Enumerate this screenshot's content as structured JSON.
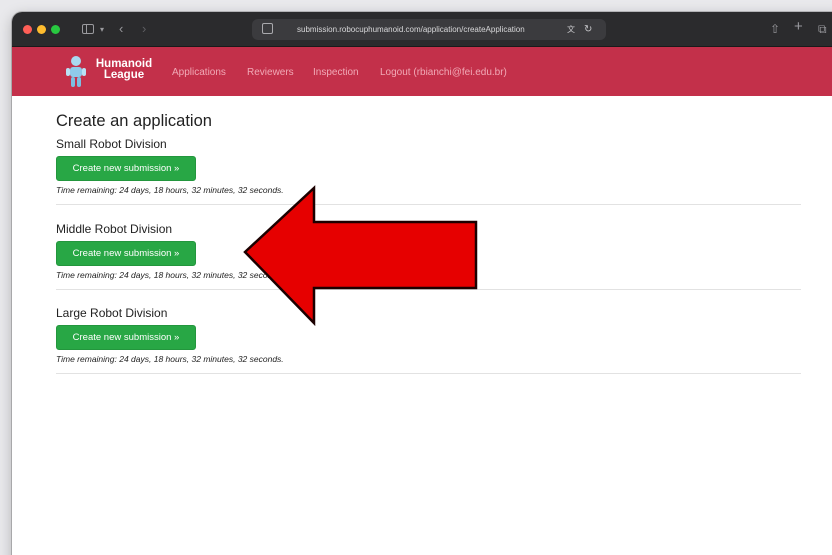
{
  "browser": {
    "url": "submission.robocuphumanoid.com/application/createApplication"
  },
  "navbar": {
    "logo_line1": "Humanoid",
    "logo_line2": "League",
    "links": [
      "Applications",
      "Reviewers",
      "Inspection",
      "Logout (rbianchi@fei.edu.br)"
    ]
  },
  "page": {
    "title": "Create an application",
    "divisions": [
      {
        "name": "Small Robot Division",
        "button_label": "Create new submission »",
        "remaining": "Time remaining: 24 days, 18 hours, 32 minutes, 32 seconds."
      },
      {
        "name": "Middle Robot Division",
        "button_label": "Create new submission »",
        "remaining": "Time remaining: 24 days, 18 hours, 32 minutes, 32 seconds."
      },
      {
        "name": "Large Robot Division",
        "button_label": "Create new submission »",
        "remaining": "Time remaining: 24 days, 18 hours, 32 minutes, 32 seconds."
      }
    ]
  },
  "colors": {
    "navbar": "#c3304a",
    "button": "#28a745",
    "arrow": "#e60000"
  },
  "icons": [
    "sidebar-icon",
    "back-icon",
    "forward-icon",
    "share-icon",
    "new-tab-icon",
    "tabs-overview-icon",
    "reload-icon",
    "translate-icon",
    "robot-logo-icon"
  ]
}
